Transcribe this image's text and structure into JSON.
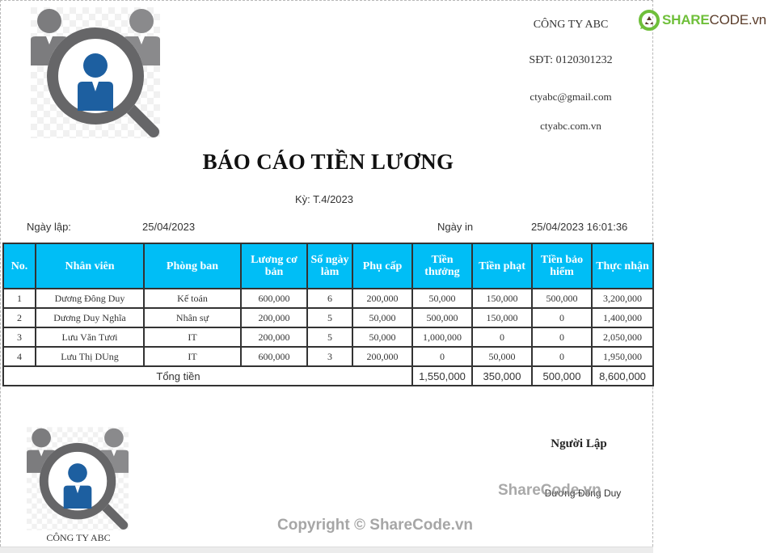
{
  "company": {
    "name": "CÔNG TY ABC",
    "phone": "SĐT: 0120301232",
    "email": "ctyabc@gmail.com",
    "website": "ctyabc.com.vn"
  },
  "brand": {
    "share": "SHARE",
    "code": "CODE.vn",
    "primary_color": "#6fbf3a",
    "secondary_color": "#5b3d2b"
  },
  "report": {
    "title": "BÁO CÁO TIỀN LƯƠNG",
    "period": "Kỳ: T.4/2023",
    "created_label": "Ngày lập:",
    "created_value": "25/04/2023",
    "printed_label": "Ngày in",
    "printed_value": "25/04/2023 16:01:36"
  },
  "table": {
    "header_color": "#00bef6",
    "headers": [
      "No.",
      "Nhân viên",
      "Phòng ban",
      "Lương cơ bản",
      "Số ngày làm",
      "Phụ cấp",
      "Tiền thưởng",
      "Tiền phạt",
      "Tiền bảo hiểm",
      "Thực nhận"
    ],
    "rows": [
      [
        "1",
        "Dương Đông Duy",
        "Kế toán",
        "600,000",
        "6",
        "200,000",
        "50,000",
        "150,000",
        "500,000",
        "3,200,000"
      ],
      [
        "2",
        "Dương Duy Nghĩa",
        "Nhân sự",
        "200,000",
        "5",
        "50,000",
        "500,000",
        "150,000",
        "0",
        "1,400,000"
      ],
      [
        "3",
        "Lưu Văn Tươi",
        "IT",
        "200,000",
        "5",
        "50,000",
        "1,000,000",
        "0",
        "0",
        "2,050,000"
      ],
      [
        "4",
        "Lưu Thị DUng",
        "IT",
        "600,000",
        "3",
        "200,000",
        "0",
        "50,000",
        "0",
        "1,950,000"
      ]
    ],
    "total": {
      "label": "Tổng tiền",
      "bonus": "1,550,000",
      "penalty": "350,000",
      "insurance": "500,000",
      "net": "8,600,000"
    }
  },
  "footer": {
    "signer_title": "Người Lập",
    "signer_name": "Dương Đông Duy",
    "company_caption": "CÔNG TY ABC"
  },
  "watermarks": {
    "mid": "ShareCode.vn",
    "copyright": "Copyright © ShareCode.vn"
  }
}
